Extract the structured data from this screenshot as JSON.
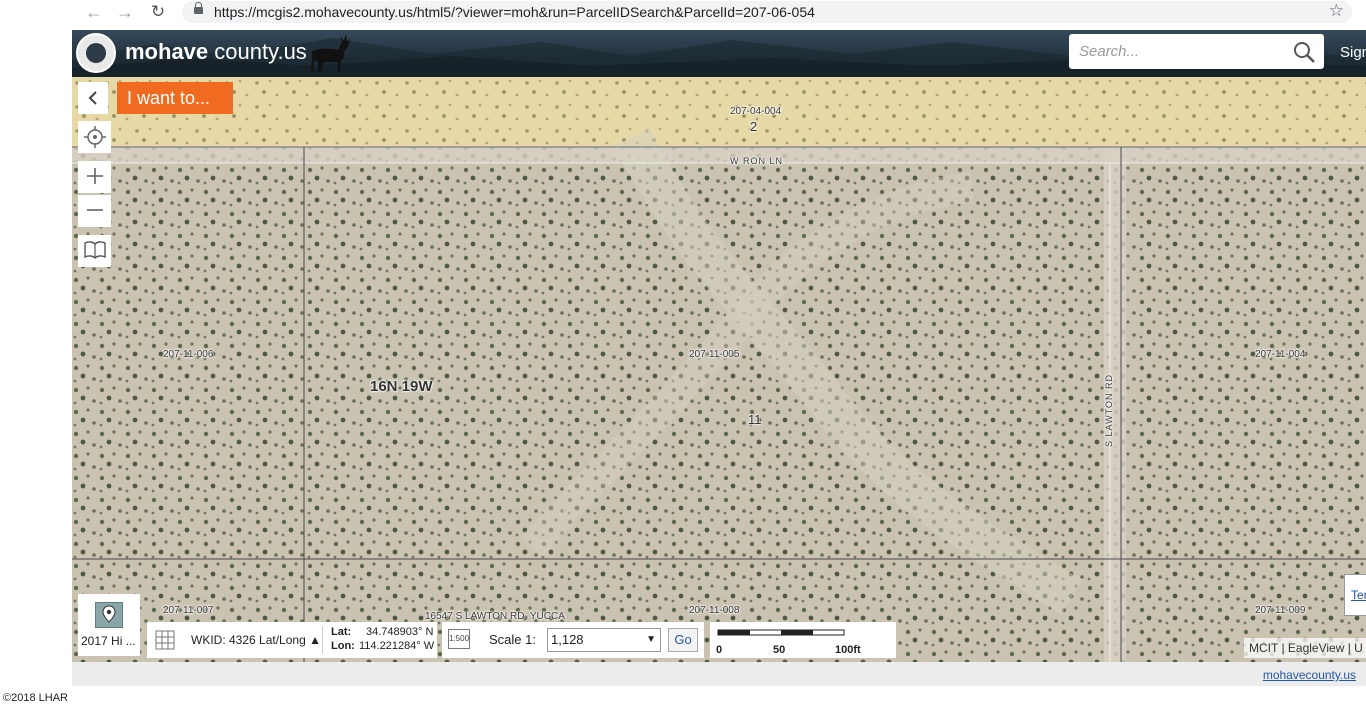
{
  "browser": {
    "url": "https://mcgis2.mohavecounty.us/html5/?viewer=moh&run=ParcelIDSearch&ParcelId=207-06-054"
  },
  "header": {
    "brand_bold": "mohave",
    "brand_rest": " county.us",
    "search_placeholder": "Search...",
    "signin": "Sign"
  },
  "toolbar": {
    "collapse_icon": "chevron-left-icon",
    "iwant_label": "I want to..."
  },
  "map": {
    "labels": {
      "parcel_top": "207-04-004",
      "parcel_top_num": "2",
      "road_top": "W RON LN",
      "parcel_left": "207-11-006",
      "township": "16N 19W",
      "parcel_center": "207-11-005",
      "parcel_center_num": "11",
      "road_right": "S LAWTON RD",
      "parcel_right": "207-11-004",
      "parcel_bl": "207-11-007",
      "address": "16547 S LAWTON RD, YUCCA",
      "parcel_bc": "207-11-008",
      "parcel_br": "207-11-009"
    },
    "colors": {
      "terrain": "#cbc3b2",
      "parcel_top_fill": "#e6d7a3",
      "parcel_line": "#4a4a4a"
    }
  },
  "basemap": {
    "label": "2017 Hi ..."
  },
  "coords": {
    "wkid": "WKID: 4326 Lat/Long ▲",
    "lat_label": "Lat:",
    "lat_value": "34.748903° N",
    "lon_label": "Lon:",
    "lon_value": "114.221284° W"
  },
  "scale": {
    "icon_text": "1:500",
    "label": "Scale 1:",
    "value": "1,128",
    "go": "Go",
    "ruler_ticks": [
      "0",
      "50",
      "100ft"
    ]
  },
  "attribution": "MCIT | EagleView | U",
  "terms": "Ter",
  "footer": {
    "link": "mohavecounty.us"
  },
  "copyright": "©2018 LHAR"
}
